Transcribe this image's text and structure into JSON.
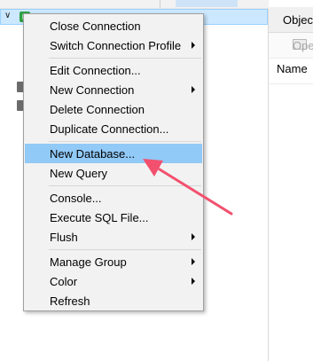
{
  "navigation": {
    "connection_row": {
      "selected": true
    }
  },
  "object_pane": {
    "tab_label": "Objects",
    "toolbar_open_label": "Open",
    "column_name_label": "Name"
  },
  "context_menu": {
    "items": [
      {
        "label": "Close Connection",
        "submenu": false
      },
      {
        "label": "Switch Connection Profile",
        "submenu": true
      },
      {
        "label": "Edit Connection...",
        "submenu": false
      },
      {
        "label": "New Connection",
        "submenu": true
      },
      {
        "label": "Delete Connection",
        "submenu": false
      },
      {
        "label": "Duplicate Connection...",
        "submenu": false
      },
      {
        "label": "New Database...",
        "submenu": false,
        "highlighted": true
      },
      {
        "label": "New Query",
        "submenu": false
      },
      {
        "label": "Console...",
        "submenu": false
      },
      {
        "label": "Execute SQL File...",
        "submenu": false
      },
      {
        "label": "Flush",
        "submenu": true
      },
      {
        "label": "Manage Group",
        "submenu": true
      },
      {
        "label": "Color",
        "submenu": true
      },
      {
        "label": "Refresh",
        "submenu": false
      }
    ]
  },
  "colors": {
    "highlight": "#91c9f7",
    "selection": "#cce8ff",
    "annotation_arrow": "#f2506e"
  },
  "icons": {
    "expand": "chevron-down-icon",
    "connection": "database-connection-icon",
    "folder": "folder-icon"
  }
}
